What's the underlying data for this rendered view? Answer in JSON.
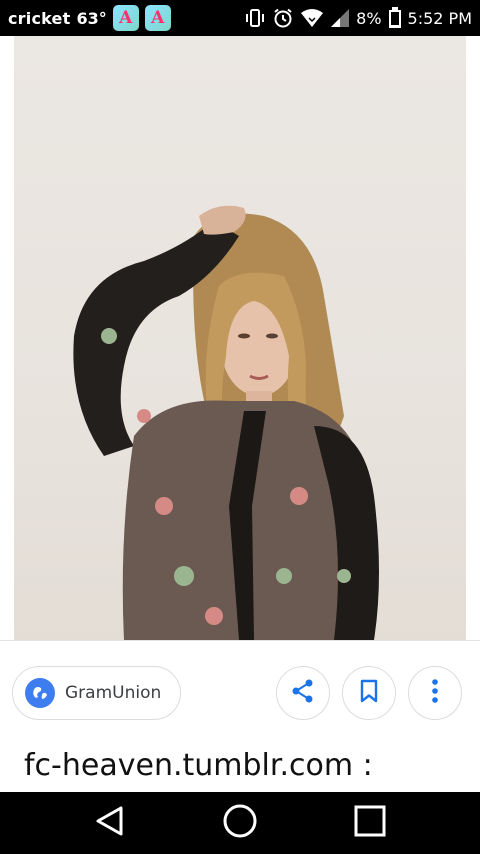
{
  "status_bar": {
    "carrier": "cricket",
    "temperature": "63°",
    "app_badge_glyph": "A",
    "battery": "8%",
    "time": "5:52 PM",
    "icons": [
      "vibrate-icon",
      "alarm-icon",
      "wifi-icon",
      "signal-icon",
      "battery-icon"
    ]
  },
  "image_viewer": {
    "source_name": "GramUnion",
    "page_title": "fc-heaven.tumblr.com :",
    "actions": [
      "share-icon",
      "bookmark-icon",
      "more-vert-icon"
    ]
  },
  "navigation_bar": {
    "buttons": [
      "back-icon",
      "home-icon",
      "recents-icon"
    ]
  },
  "colors": {
    "accent": "#1a73e8",
    "globe": "#3d7df0",
    "badge_letter": "#ff2f6d"
  }
}
